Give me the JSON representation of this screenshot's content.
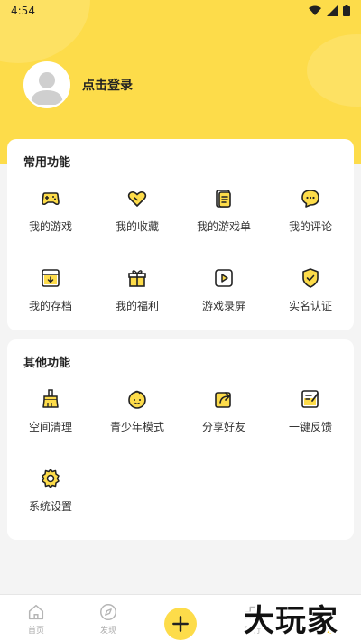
{
  "status_bar": {
    "time": "4:54"
  },
  "profile": {
    "login_text": "点击登录"
  },
  "common": {
    "title": "常用功能",
    "items": [
      {
        "label": "我的游戏",
        "icon": "gamepad-icon"
      },
      {
        "label": "我的收藏",
        "icon": "heart-icon"
      },
      {
        "label": "我的游戏单",
        "icon": "list-doc-icon"
      },
      {
        "label": "我的评论",
        "icon": "comment-icon"
      },
      {
        "label": "我的存档",
        "icon": "archive-icon"
      },
      {
        "label": "我的福利",
        "icon": "gift-icon"
      },
      {
        "label": "游戏录屏",
        "icon": "record-play-icon"
      },
      {
        "label": "实名认证",
        "icon": "shield-check-icon"
      }
    ]
  },
  "other": {
    "title": "其他功能",
    "items": [
      {
        "label": "空间清理",
        "icon": "broom-icon"
      },
      {
        "label": "青少年模式",
        "icon": "child-face-icon"
      },
      {
        "label": "分享好友",
        "icon": "share-icon"
      },
      {
        "label": "一键反馈",
        "icon": "feedback-edit-icon"
      },
      {
        "label": "系统设置",
        "icon": "gear-icon"
      }
    ]
  },
  "tabbar": {
    "items": [
      {
        "label": "首页",
        "icon": "home-icon"
      },
      {
        "label": "发现",
        "icon": "compass-icon"
      },
      {
        "label": "",
        "icon": "plus-icon"
      },
      {
        "label": "排行",
        "icon": "ranking-icon"
      },
      {
        "label": "我的",
        "icon": "profile-icon"
      }
    ]
  },
  "watermark": "大玩家",
  "colors": {
    "accent": "#fddc4a",
    "icon_fill": "#fddc4a",
    "stroke": "#222222",
    "background": "#f4f4f4"
  }
}
